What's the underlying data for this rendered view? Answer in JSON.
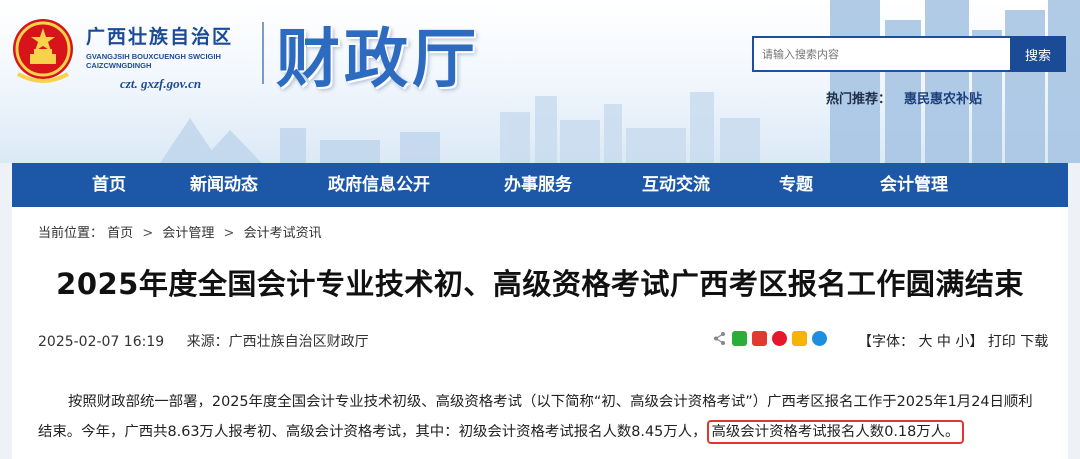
{
  "header": {
    "org_name_cn": "广西壮族自治区",
    "org_name_za_line1": "GVANGJSIH BOUXCUENGH SWCIGIH",
    "org_name_za_line2": "CAIZCWNGDINGH",
    "domain": "czt. gxzf.gov.cn",
    "dept_title": "财政厅",
    "search_placeholder": "请输入搜索内容",
    "search_button": "搜索",
    "hot_label": "热门推荐：",
    "hot_link": "惠民惠农补贴"
  },
  "nav": {
    "items": [
      {
        "label": "首页"
      },
      {
        "label": "新闻动态"
      },
      {
        "label": "政府信息公开"
      },
      {
        "label": "办事服务"
      },
      {
        "label": "互动交流"
      },
      {
        "label": "专题"
      },
      {
        "label": "会计管理"
      }
    ]
  },
  "breadcrumb": {
    "prefix": "当前位置：",
    "items": [
      "首页",
      "会计管理",
      "会计考试资讯"
    ],
    "separator": ">"
  },
  "article": {
    "title": "2025年度全国会计专业技术初、高级资格考试广西考区报名工作圆满结束",
    "date": "2025-02-07 16:19",
    "source_label": "来源：",
    "source": "广西壮族自治区财政厅",
    "font_size_label": "【字体：",
    "font_large": "大",
    "font_medium": "中",
    "font_small": "小",
    "font_close": "】",
    "print": "打印",
    "download": "下载",
    "body_part1": "按照财政部统一部署，2025年度全国会计专业技术初级、高级资格考试（以下简称“初、高级会计资格考试”）广西考区报名工作于2025年1月24日顺利结束。今年，广西共8.63万人报考初、高级会计资格考试，其中：初级会计资格考试报名人数8.45万人，",
    "body_highlight": "高级会计资格考试报名人数0.18万人。"
  },
  "share_icons": [
    {
      "name": "share-icon",
      "color": "#8a8a8a"
    },
    {
      "name": "wechat-icon",
      "color": "#2aae3a"
    },
    {
      "name": "toutiao-icon",
      "color": "#e23a2e"
    },
    {
      "name": "weibo-icon",
      "color": "#e6162d"
    },
    {
      "name": "qzone-icon",
      "color": "#f6b400"
    },
    {
      "name": "qq-icon",
      "color": "#1e8fe0"
    }
  ],
  "colors": {
    "brand_blue": "#1c58a7",
    "title_blue": "#2c6bc0",
    "highlight_red": "#e5352f"
  }
}
